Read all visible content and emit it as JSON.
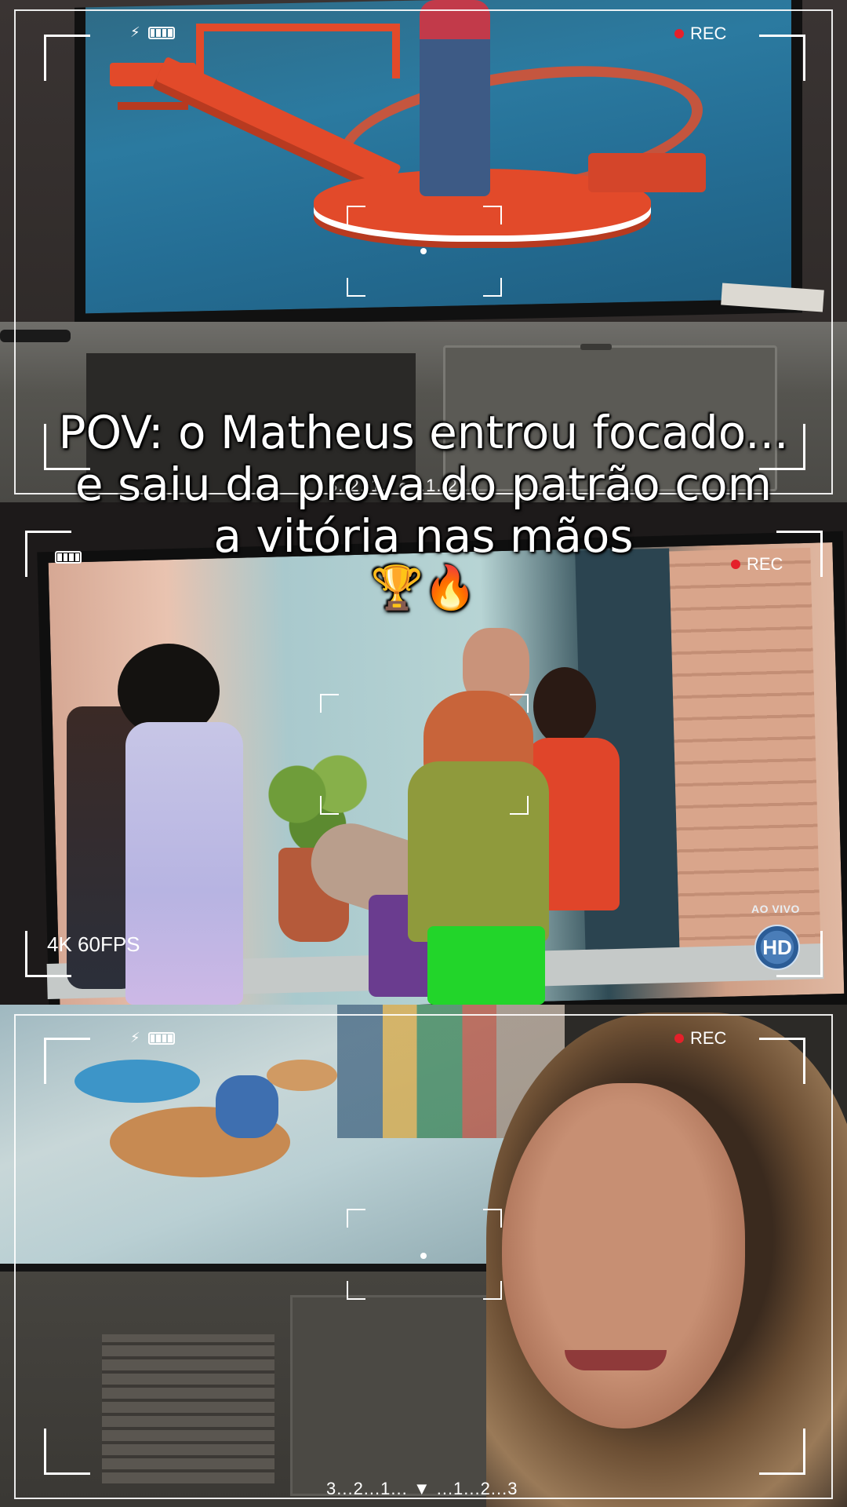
{
  "caption": {
    "text": "POV: o Matheus entrou focado... e saiu da prova do patrão com a vitória nas mãos",
    "emojis": "🏆🔥"
  },
  "camera_overlay": {
    "top": {
      "rec_label": "REC",
      "countdown": "3..2..1.. ● ..1..2..3"
    },
    "middle": {
      "rec_label": "REC",
      "fps_label": "4K 60FPS",
      "tv_live_label": "AO VIVO",
      "tv_hd_label": "HD"
    },
    "bottom": {
      "rec_label": "REC",
      "countdown": "3...2...1... ▼ ...1...2...3"
    }
  },
  "icons": {
    "flash": "lightning-bolt-icon",
    "battery": "battery-full-icon",
    "rec": "red-record-dot-icon"
  },
  "colors": {
    "rec_dot": "#e5202a",
    "overlay": "#ffffff"
  }
}
